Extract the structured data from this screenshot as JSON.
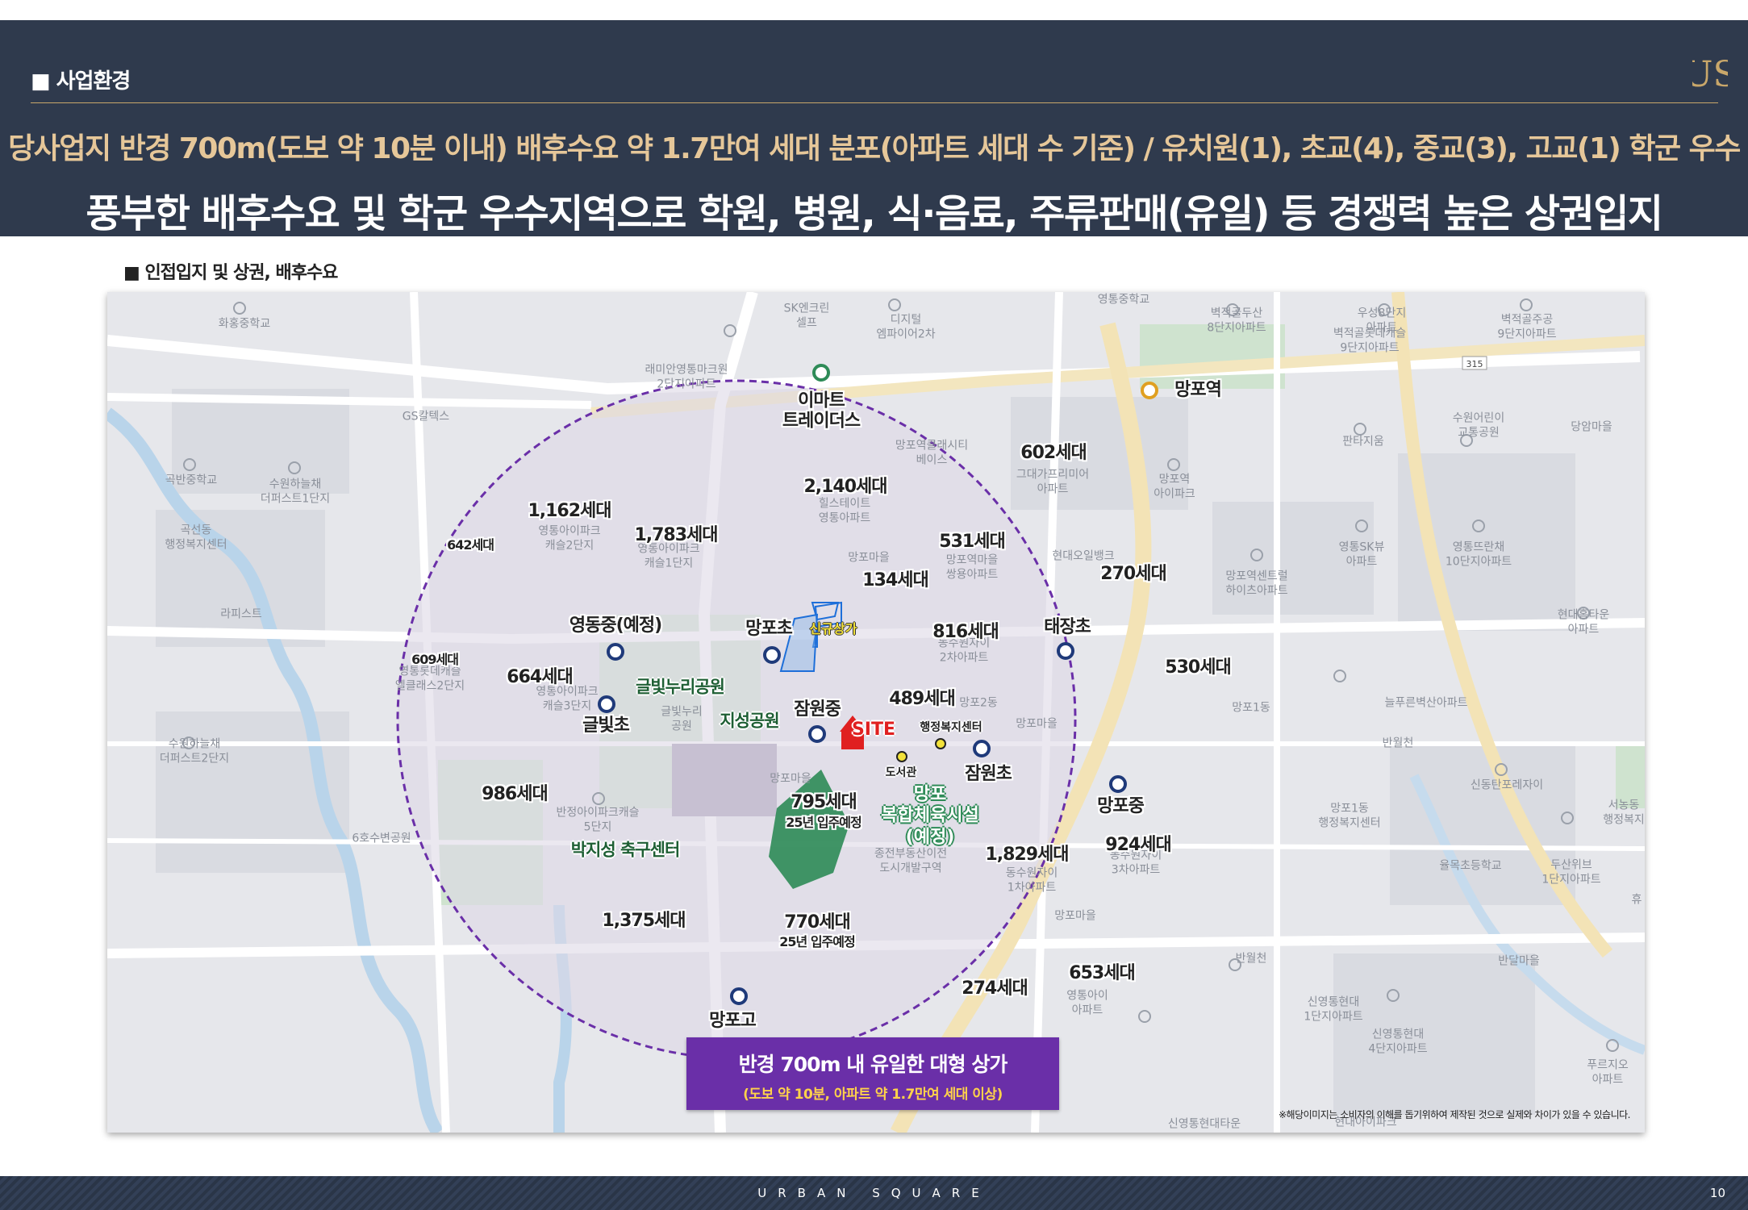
{
  "header": {
    "section_title": "■ 사업환경",
    "logo_text": "US",
    "headline1": "당사업지 반경 700m(도보 약 10분 이내) 배후수요 약 1.7만여 세대 분포(아파트 세대 수 기준) / 유치원(1), 초교(4), 중교(3), 고교(1) 학군 우수",
    "headline2": "풍부한 배후수요 및 학군 우수지역으로 학원, 병원, 식·음료, 주류판매(유일) 등 경쟁력 높은 상권입지"
  },
  "sub_title": "■ 인접입지 및 상권, 배후수요",
  "map": {
    "site_label": "SITE",
    "new_retail_label": "신규상가",
    "road_number": "315",
    "station": "망포역",
    "mart": "이마트\n트레이더스",
    "sports": "망포\n복합체육시설\n(예정)",
    "library": "도서관",
    "welfare": "행정복지센터",
    "base_labels": [
      "SK엔크린\n셀프",
      "디지털\n엠파이어2차",
      "화홍중학교",
      "래미안영통마크원\n2단지아파트",
      "GS칼텍스",
      "망포역클래시티\n베이스",
      "곡반중학교",
      "수원하늘채\n더퍼스트1단지",
      "곡선동\n행정복지센터",
      "힐스테이트\n영통아파트",
      "그대가프리미어\n아파트",
      "망포역\n아이파크",
      "영통아이파크\n캐슬2단지",
      "영통아이파크\n캐슬1단지",
      "망포마을",
      "망포역마을\n쌍용아파트",
      "현대오일뱅크",
      "라피스트",
      "영통롯데캐슬\n엘클래스2단지",
      "영통아이파크\n캐슬3단지",
      "글빛누리\n공원",
      "동수원자이\n2차아파트",
      "망포2동",
      "망포마을",
      "망포1동",
      "수원하늘채\n더퍼스트2단지",
      "망포마을",
      "반정아이파크캐슬\n5단지",
      "6호수변공원",
      "종전부동산이전\n도시개발구역",
      "동수원자이\n1차아파트",
      "동수원자이\n3차아파트",
      "망포마을",
      "망포역센트럴\n하이츠아파트",
      "늘푸른벽산아파트",
      "반월천",
      "신동탄포레자이",
      "망포1동\n행정복지센터",
      "율목초등학교",
      "두산위브\n1단지아파트",
      "반월천",
      "신영통현대\n1단지아파트",
      "신영통현대\n4단지아파트",
      "반달마을",
      "푸르지오\n아파트",
      "신영통현대타운",
      "현대아이파크",
      "영통중학교",
      "벽적골두산\n8단지아파트",
      "우성8단지\n아파트",
      "벽적골롯데캐슬\n9단지아파트",
      "벽적골주공\n9단지아파트",
      "판타지움",
      "수원어린이\n교통공원",
      "당암마을",
      "영통SK뷰\n아파트",
      "영통뜨란채\n10단지아파트",
      "현대홈타운\n아파트",
      "서농동\n행정복지",
      "휴",
      "영통아이\n아파트"
    ],
    "counts": [
      "602세대",
      "2,140세대",
      "1,162세대",
      "1,783세대",
      "642세대",
      "531세대",
      "134세대",
      "270세대",
      "816세대",
      "530세대",
      "609세대",
      "664세대",
      "489세대",
      "986세대",
      "795세대",
      "25년 입주예정",
      "924세대",
      "1,829세대",
      "1,375세대",
      "770세대",
      "25년 입주예정",
      "653세대",
      "274세대"
    ],
    "schools": [
      "영동중(예정)",
      "망포초",
      "태장초",
      "글빛초",
      "잠원중",
      "잠원초",
      "망포중",
      "망포고"
    ],
    "parks": [
      "글빛누리공원",
      "지성공원",
      "박지성 축구센터"
    ],
    "callout_title": "반경 700m 내 유일한 대형 상가",
    "callout_sub": "(도보 약 10분, 아파트 약 1.7만여 세대 이상)",
    "note": "※해당이미지는 소비자의 이해를 돕기위하여 제작된 것으로 실제와 차이가 있을 수 있습니다."
  },
  "footer": {
    "brand": "URBAN SQUARE",
    "page": "10"
  },
  "colors": {
    "header_bg": "#2f3a4d",
    "gold": "#e6c799",
    "circle": "#6a2fa8",
    "school_marker": "#1f3a7a",
    "park_green": "#2e8b57",
    "site_red": "#e02020"
  }
}
